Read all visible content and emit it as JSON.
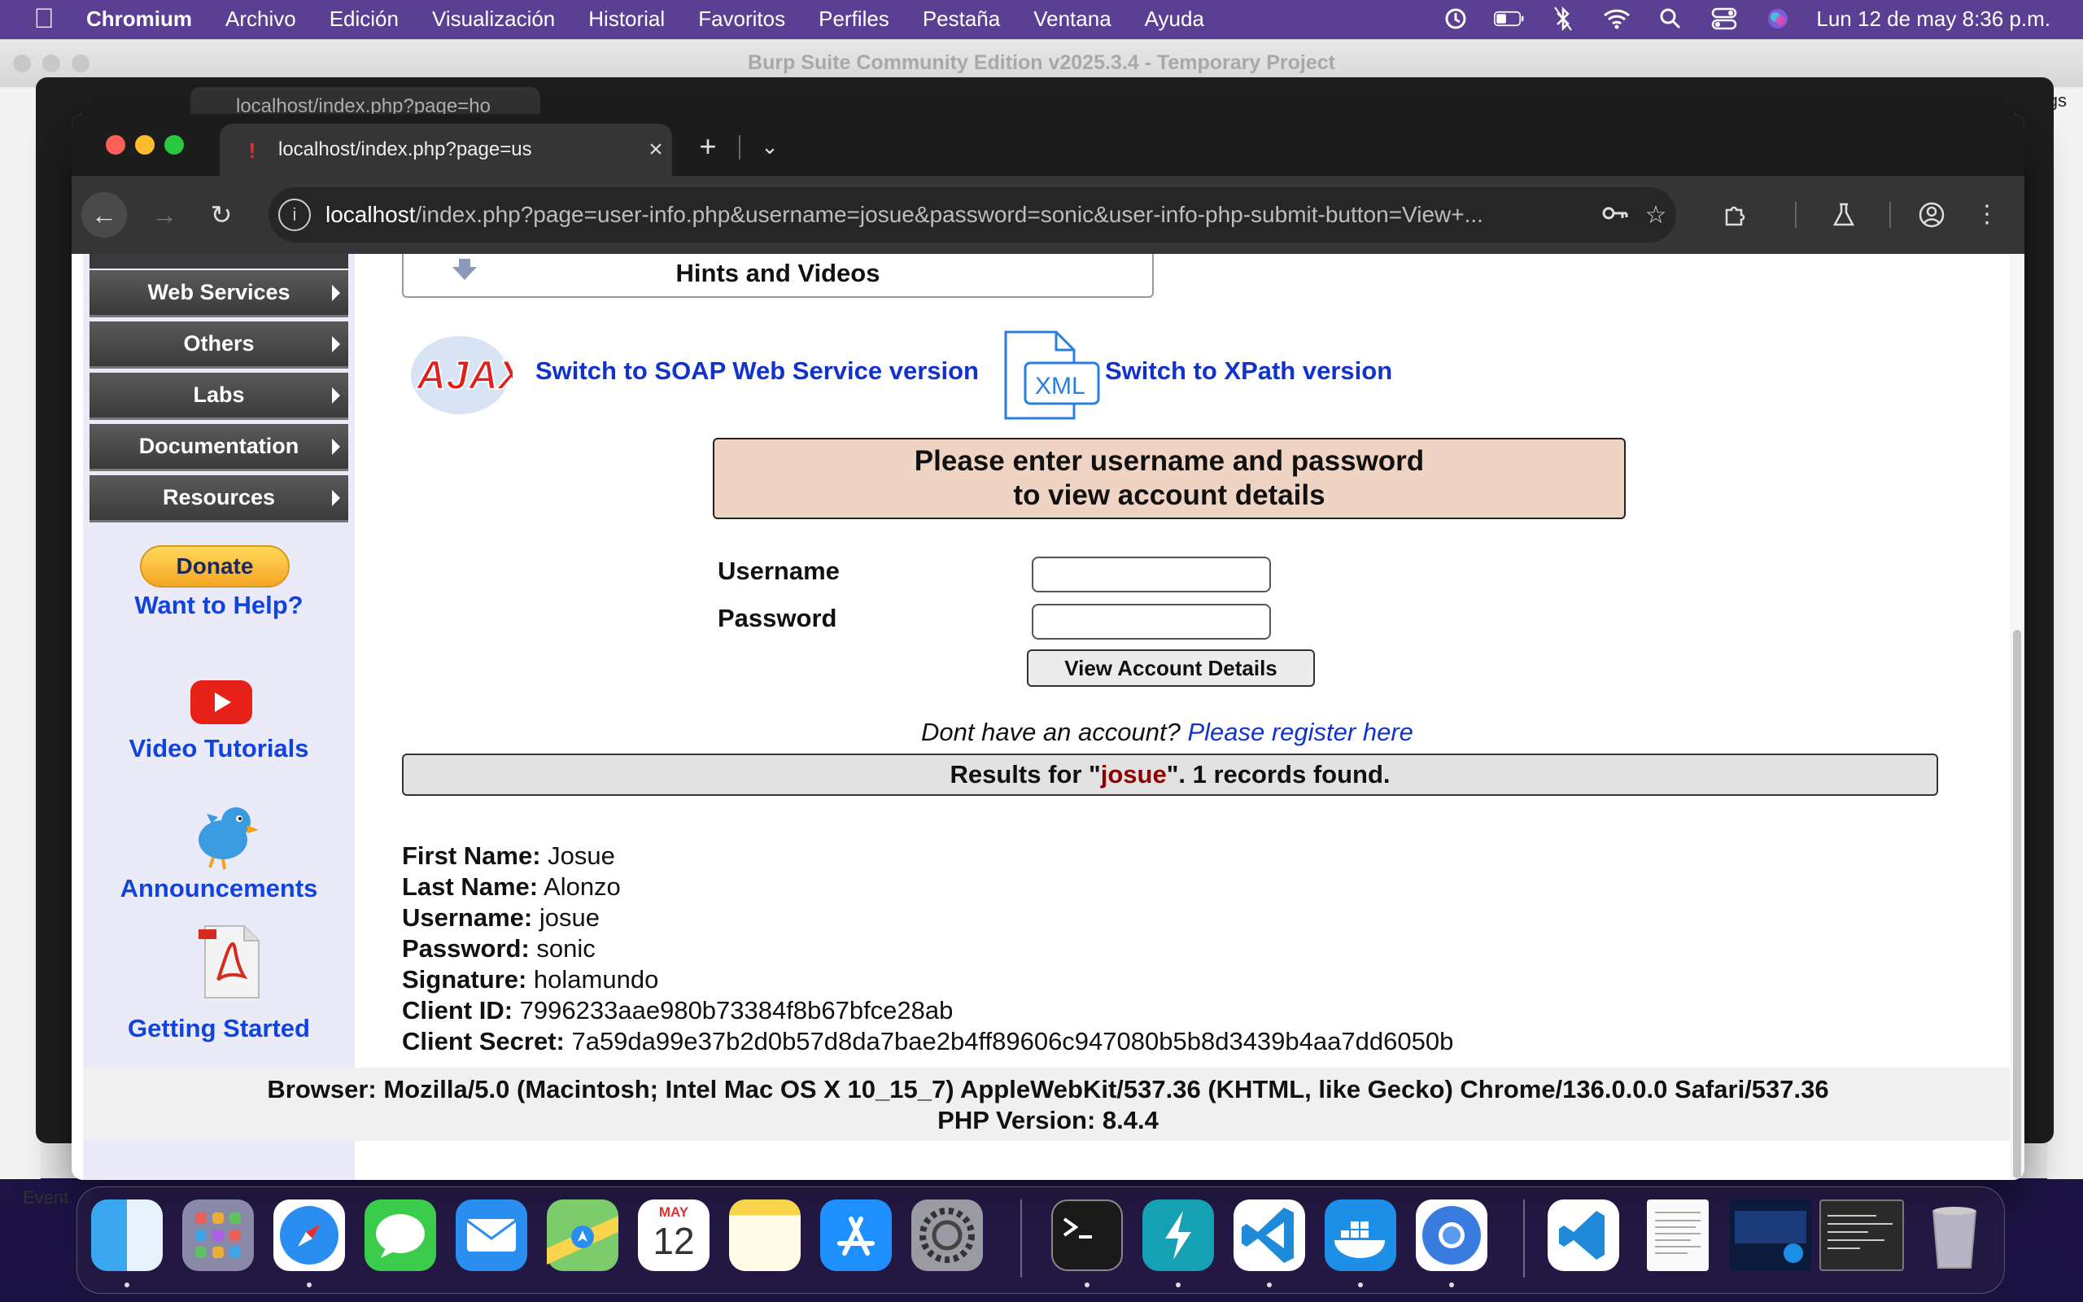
{
  "menubar": {
    "app": "Chromium",
    "items": [
      "Archivo",
      "Edición",
      "Visualización",
      "Historial",
      "Favoritos",
      "Perfiles",
      "Pestaña",
      "Ventana",
      "Ayuda"
    ],
    "clock": "Lun 12 de may  8:36 p.m."
  },
  "burp": {
    "title": "Burp Suite Community Edition v2025.3.4 - Temporary Project",
    "settings": "Settings",
    "event": "Event"
  },
  "back_tab": "localhost/index.php?page=ho",
  "browser": {
    "tab_title": "localhost/index.php?page=us",
    "url_host": "localhost",
    "url_path": "/index.php?page=user-info.php&username=josue&password=sonic&user-info-php-submit-button=View+..."
  },
  "sidebar": {
    "menu": [
      "Web Services",
      "Others",
      "Labs",
      "Documentation",
      "Resources"
    ],
    "donate": "Donate",
    "want_help": "Want to Help?",
    "video_tutorials": "Video Tutorials",
    "announcements": "Announcements",
    "getting_started": "Getting Started"
  },
  "main": {
    "hints": "Hints and Videos",
    "ajax_logo": "AJAX",
    "soap_link": "Switch to SOAP Web Service version",
    "xml_label": "XML",
    "xpath_link": "Switch to XPath version",
    "login_line1": "Please enter username and password",
    "login_line2": "to view account details",
    "username_label": "Username",
    "password_label": "Password",
    "view_button": "View Account Details",
    "no_account": "Dont have an account? ",
    "register_link": "Please register here",
    "results_prefix": "Results for \"",
    "results_query": "josue",
    "results_suffix": "\". 1 records found.",
    "records": [
      {
        "label": "First Name:",
        "value": " Josue"
      },
      {
        "label": "Last Name:",
        "value": " Alonzo"
      },
      {
        "label": "Username:",
        "value": " josue"
      },
      {
        "label": "Password:",
        "value": " sonic"
      },
      {
        "label": "Signature:",
        "value": " holamundo"
      },
      {
        "label": "Client ID:",
        "value": " 7996233aae980b73384f8b67bfce28ab"
      },
      {
        "label": "Client Secret:",
        "value": " 7a59da99e37b2d0b57d8da7bae2b4ff89606c947080b5b8d3439b4aa7dd6050b"
      }
    ],
    "footer_browser": "Browser: Mozilla/5.0 (Macintosh; Intel Mac OS X 10_15_7) AppleWebKit/537.36 (KHTML, like Gecko) Chrome/136.0.0.0 Safari/537.36",
    "footer_php": "PHP Version: 8.4.4"
  },
  "dock": {
    "calendar_month": "MAY",
    "calendar_day": "12",
    "apps": [
      "finder-icon",
      "launchpad-icon",
      "safari-icon",
      "messages-icon",
      "mail-icon",
      "maps-icon",
      "calendar-icon",
      "notes-icon",
      "app-store-icon",
      "system-settings-icon",
      "terminal-icon",
      "burp-icon",
      "vscode-icon",
      "docker-icon",
      "chromium-icon",
      "vscode-doc-icon",
      "document-icon",
      "screenshot-icon",
      "window-icon",
      "trash-icon"
    ]
  }
}
